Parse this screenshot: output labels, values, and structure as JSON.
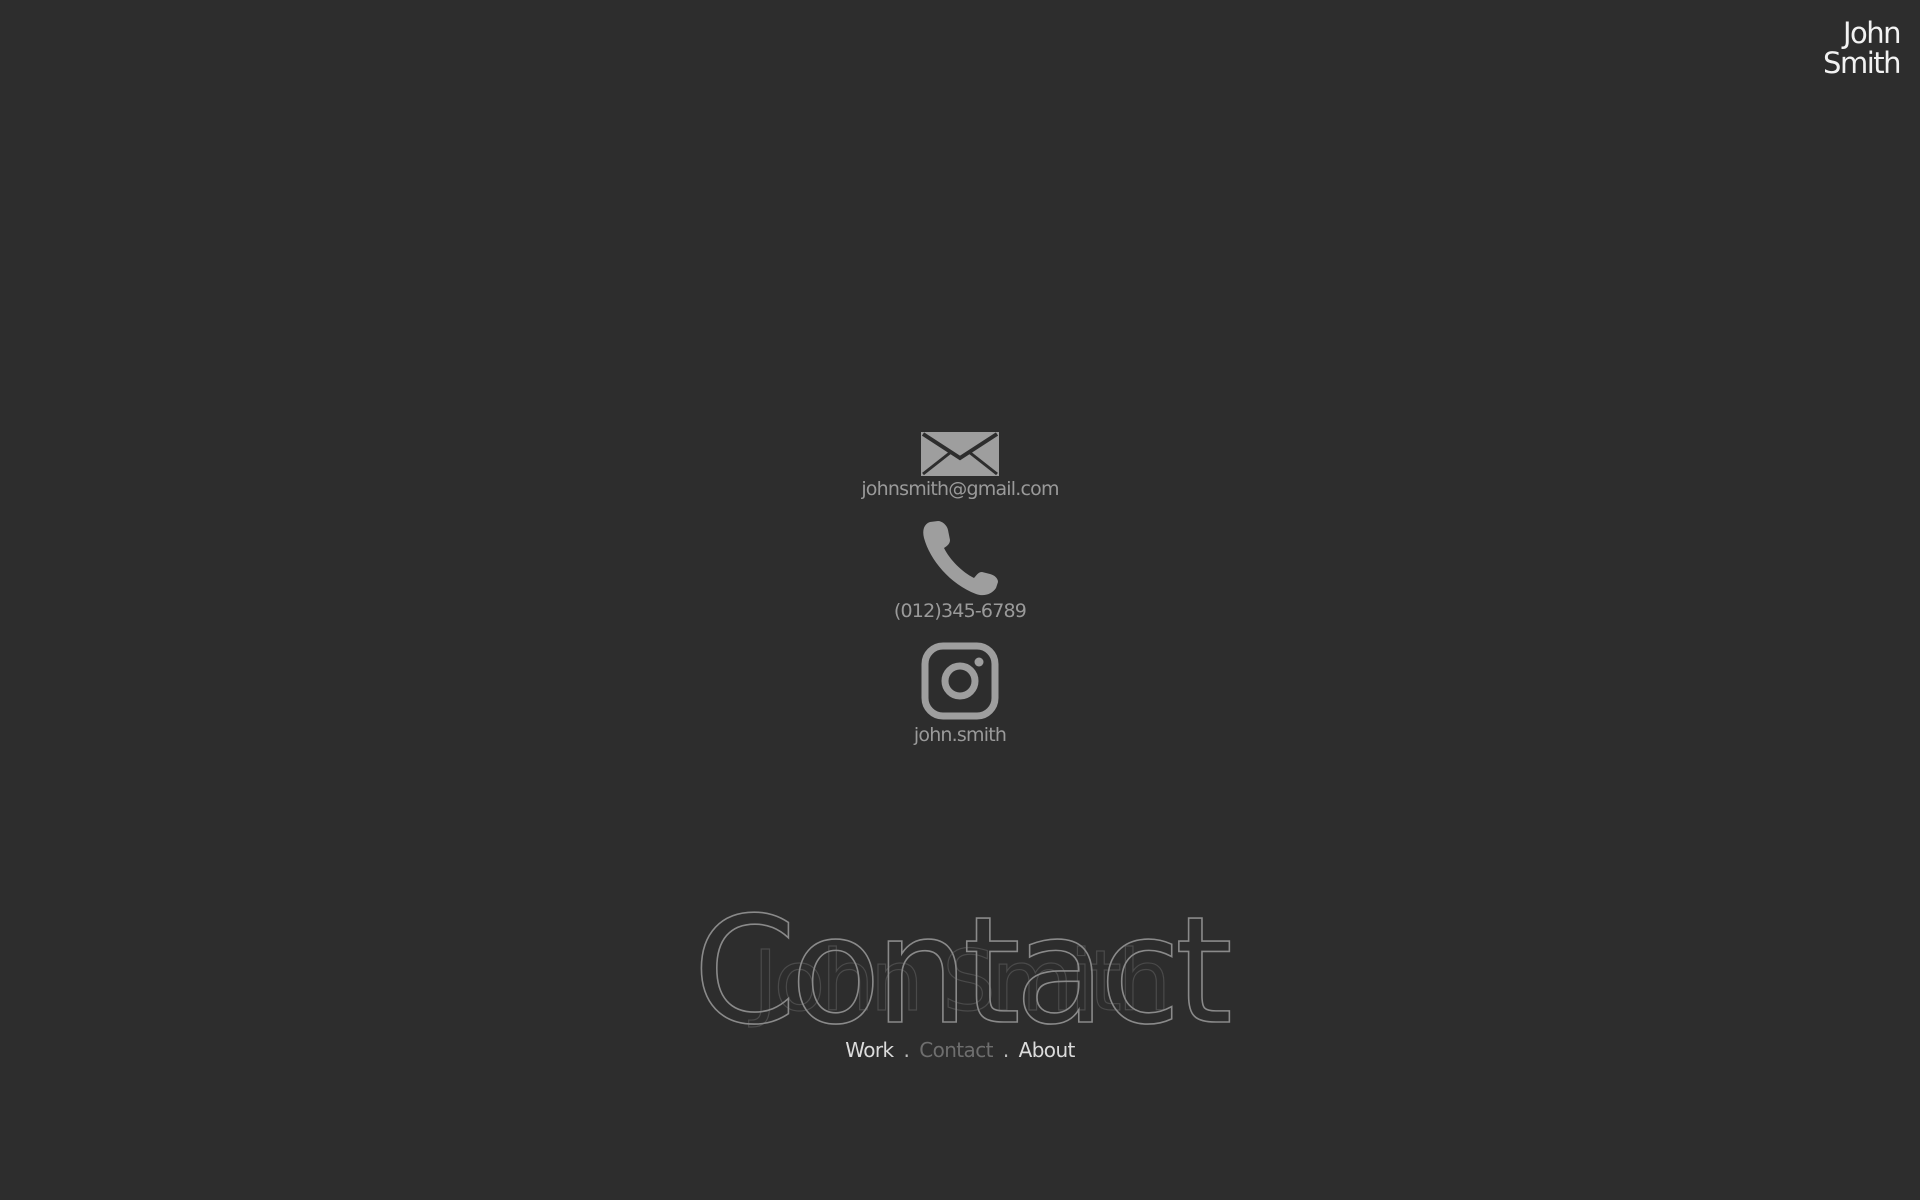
{
  "logo": {
    "line1": "John",
    "line2": "Smith"
  },
  "contacts": {
    "email": {
      "icon": "envelope-icon",
      "label": "johnsmith@gmail.com"
    },
    "phone": {
      "icon": "phone-icon",
      "label": "(012)345-6789"
    },
    "instagram": {
      "icon": "instagram-icon",
      "label": "john.smith"
    }
  },
  "heading": {
    "foreground": "Contact",
    "background": "John Smith"
  },
  "nav": {
    "items": [
      "Work",
      "Contact",
      "About"
    ],
    "separator": ".",
    "active": "Contact"
  },
  "colors": {
    "background": "#2d2d2d",
    "text": "#f2f2f2",
    "muted": "#9a9a9a",
    "active_nav": "#6e6e6e"
  }
}
